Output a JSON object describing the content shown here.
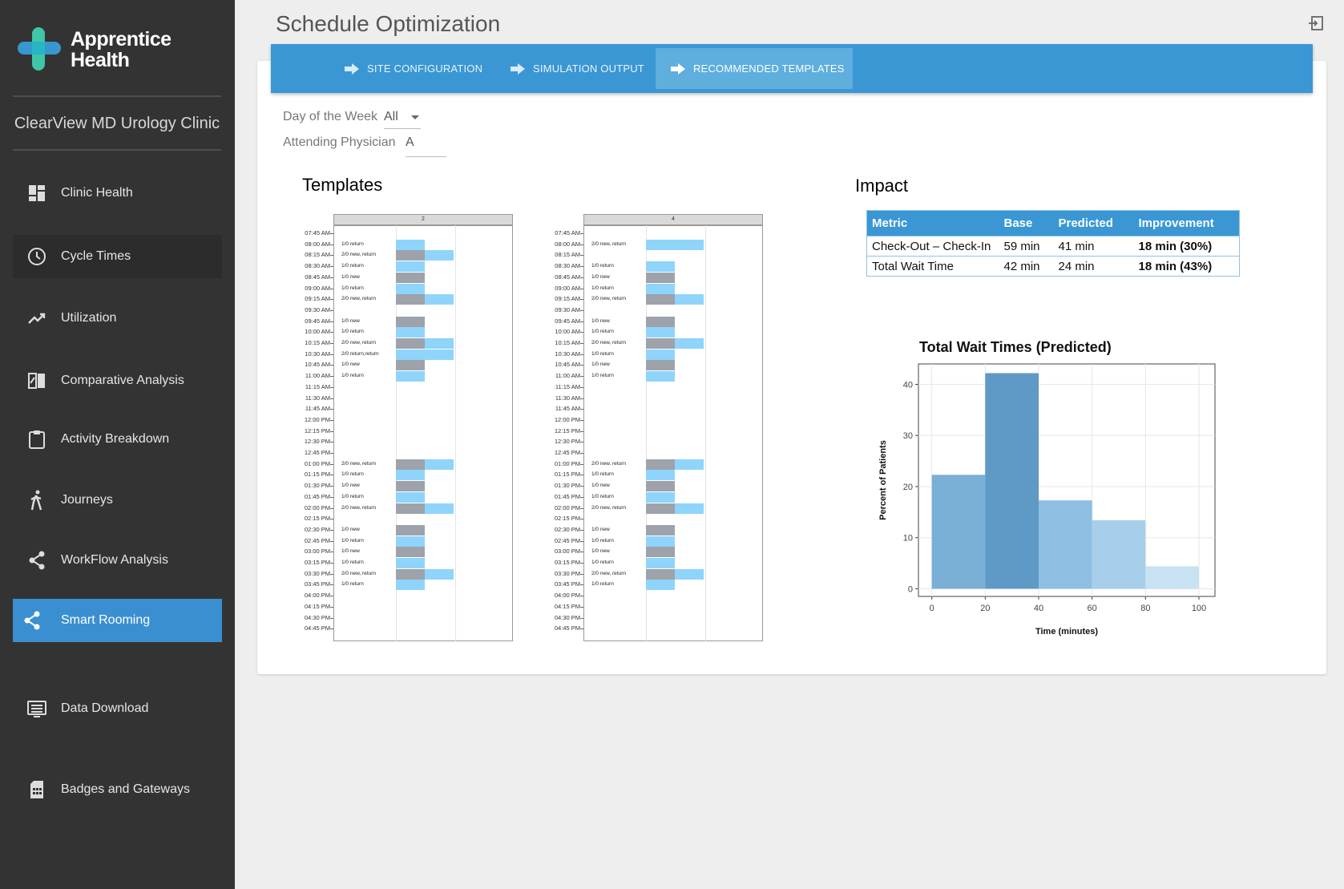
{
  "app": {
    "brand_line1": "Apprentice",
    "brand_line2": "Health",
    "clinic_name": "ClearView MD Urology Clinic",
    "logo_colors": [
      "#3ec6a8",
      "#36a3e0"
    ]
  },
  "sidebar": {
    "items": [
      {
        "label": "Clinic Health",
        "icon": "dashboard-icon"
      },
      {
        "label": "Cycle Times",
        "icon": "clock-icon"
      },
      {
        "label": "Utilization",
        "icon": "trend-icon"
      },
      {
        "label": "Comparative Analysis",
        "icon": "compare-icon"
      },
      {
        "label": "Activity Breakdown",
        "icon": "clipboard-icon"
      },
      {
        "label": "Journeys",
        "icon": "walking-icon"
      },
      {
        "label": "WorkFlow Analysis",
        "icon": "share-icon"
      },
      {
        "label": "Smart Rooming",
        "icon": "share-icon",
        "active": true
      },
      {
        "label": "Data Download",
        "icon": "list-icon"
      },
      {
        "label": "Badges and Gateways",
        "icon": "sim-card-icon"
      }
    ],
    "active_color": "#3a8fd1"
  },
  "header": {
    "title": "Schedule Optimization"
  },
  "tabs": [
    {
      "label": "SITE CONFIGURATION"
    },
    {
      "label": "SIMULATION OUTPUT"
    },
    {
      "label": "RECOMMENDED TEMPLATES",
      "active": true
    }
  ],
  "filters": {
    "day_label": "Day of the Week",
    "day_value": "All",
    "physician_label": "Attending Physician",
    "physician_value": "A"
  },
  "templates": {
    "title": "Templates",
    "times": [
      "07:45 AM",
      "08:00 AM",
      "08:15 AM",
      "08:30 AM",
      "08:45 AM",
      "09:00 AM",
      "09:15 AM",
      "09:30 AM",
      "09:45 AM",
      "10:00 AM",
      "10:15 AM",
      "10:30 AM",
      "10:45 AM",
      "11:00 AM",
      "11:15 AM",
      "11:30 AM",
      "11:45 AM",
      "12:00 PM",
      "12:15 PM",
      "12:30 PM",
      "12:45 PM",
      "01:00 PM",
      "01:15 PM",
      "01:30 PM",
      "01:45 PM",
      "02:00 PM",
      "02:15 PM",
      "02:30 PM",
      "02:45 PM",
      "03:00 PM",
      "03:15 PM",
      "03:30 PM",
      "03:45 PM",
      "04:00 PM",
      "04:15 PM",
      "04:30 PM",
      "04:45 PM"
    ],
    "panels": [
      {
        "header": "2",
        "slots": [
          {
            "row": 1,
            "text": "1/0 return",
            "blocks": [
              "blue"
            ]
          },
          {
            "row": 2,
            "text": "2/0 new, return",
            "blocks": [
              "gray",
              "blue"
            ]
          },
          {
            "row": 3,
            "text": "1/0 return",
            "blocks": [
              "blue"
            ]
          },
          {
            "row": 4,
            "text": "1/0 new",
            "blocks": [
              "gray"
            ]
          },
          {
            "row": 5,
            "text": "1/0 return",
            "blocks": [
              "blue"
            ]
          },
          {
            "row": 6,
            "text": "2/0 new, return",
            "blocks": [
              "gray",
              "blue"
            ]
          },
          {
            "row": 8,
            "text": "1/0 new",
            "blocks": [
              "gray"
            ]
          },
          {
            "row": 9,
            "text": "1/0 return",
            "blocks": [
              "blue"
            ]
          },
          {
            "row": 10,
            "text": "2/0 new, return",
            "blocks": [
              "gray",
              "blue"
            ]
          },
          {
            "row": 11,
            "text": "2/0 return,return",
            "blocks": [
              "blue",
              "blue"
            ]
          },
          {
            "row": 12,
            "text": "1/0 new",
            "blocks": [
              "gray"
            ]
          },
          {
            "row": 13,
            "text": "1/0 return",
            "blocks": [
              "blue"
            ]
          },
          {
            "row": 21,
            "text": "2/0 new, return",
            "blocks": [
              "gray",
              "blue"
            ]
          },
          {
            "row": 22,
            "text": "1/0 return",
            "blocks": [
              "blue"
            ]
          },
          {
            "row": 23,
            "text": "1/0 new",
            "blocks": [
              "gray"
            ]
          },
          {
            "row": 24,
            "text": "1/0 return",
            "blocks": [
              "blue"
            ]
          },
          {
            "row": 25,
            "text": "2/0 new, return",
            "blocks": [
              "gray",
              "blue"
            ]
          },
          {
            "row": 27,
            "text": "1/0 new",
            "blocks": [
              "gray"
            ]
          },
          {
            "row": 28,
            "text": "1/0 return",
            "blocks": [
              "blue"
            ]
          },
          {
            "row": 29,
            "text": "1/0 new",
            "blocks": [
              "gray"
            ]
          },
          {
            "row": 30,
            "text": "1/0 return",
            "blocks": [
              "blue"
            ]
          },
          {
            "row": 31,
            "text": "2/0 new, return",
            "blocks": [
              "gray",
              "blue"
            ]
          },
          {
            "row": 32,
            "text": "1/0 return",
            "blocks": [
              "blue"
            ]
          }
        ]
      },
      {
        "header": "4",
        "slots": [
          {
            "row": 1,
            "text": "2/0 new, return",
            "blocks": [
              "blue",
              "blue"
            ]
          },
          {
            "row": 3,
            "text": "1/0 return",
            "blocks": [
              "blue"
            ]
          },
          {
            "row": 4,
            "text": "1/0 new",
            "blocks": [
              "gray"
            ]
          },
          {
            "row": 5,
            "text": "1/0 return",
            "blocks": [
              "blue"
            ]
          },
          {
            "row": 6,
            "text": "2/0 new, return",
            "blocks": [
              "gray",
              "blue"
            ]
          },
          {
            "row": 8,
            "text": "1/0 new",
            "blocks": [
              "gray"
            ]
          },
          {
            "row": 9,
            "text": "1/0 return",
            "blocks": [
              "blue"
            ]
          },
          {
            "row": 10,
            "text": "2/0 new, return",
            "blocks": [
              "gray",
              "blue"
            ]
          },
          {
            "row": 11,
            "text": "1/0 return",
            "blocks": [
              "blue"
            ]
          },
          {
            "row": 12,
            "text": "1/0 new",
            "blocks": [
              "gray"
            ]
          },
          {
            "row": 13,
            "text": "1/0 return",
            "blocks": [
              "blue"
            ]
          },
          {
            "row": 21,
            "text": "2/0 new, return",
            "blocks": [
              "gray",
              "blue"
            ]
          },
          {
            "row": 22,
            "text": "1/0 return",
            "blocks": [
              "blue"
            ]
          },
          {
            "row": 23,
            "text": "1/0 new",
            "blocks": [
              "gray"
            ]
          },
          {
            "row": 24,
            "text": "1/0 return",
            "blocks": [
              "blue"
            ]
          },
          {
            "row": 25,
            "text": "2/0 new, return",
            "blocks": [
              "gray",
              "blue"
            ]
          },
          {
            "row": 27,
            "text": "1/0 new",
            "blocks": [
              "gray"
            ]
          },
          {
            "row": 28,
            "text": "1/0 return",
            "blocks": [
              "blue"
            ]
          },
          {
            "row": 29,
            "text": "1/0 new",
            "blocks": [
              "gray"
            ]
          },
          {
            "row": 30,
            "text": "1/0 return",
            "blocks": [
              "blue"
            ]
          },
          {
            "row": 31,
            "text": "2/0 new, return",
            "blocks": [
              "gray",
              "blue"
            ]
          },
          {
            "row": 32,
            "text": "1/0 return",
            "blocks": [
              "blue"
            ]
          }
        ]
      }
    ]
  },
  "impact": {
    "title": "Impact",
    "columns": [
      "Metric",
      "Base",
      "Predicted",
      "Improvement"
    ],
    "rows": [
      [
        "Check-Out – Check-In",
        "59 min",
        "41 min",
        "18 min (30%)"
      ],
      [
        "Total Wait Time",
        "42 min",
        "24 min",
        "18 min (43%)"
      ]
    ]
  },
  "chart_data": {
    "type": "bar",
    "title": "Total Wait Times (Predicted)",
    "xlabel": "Time (minutes)",
    "ylabel": "Percent of Patients",
    "bins": [
      [
        0,
        20
      ],
      [
        20,
        40
      ],
      [
        40,
        60
      ],
      [
        60,
        80
      ],
      [
        80,
        100
      ]
    ],
    "values": [
      22.3,
      42.2,
      17.3,
      13.4,
      4.4
    ],
    "colors": [
      "#7aafd6",
      "#5f99c6",
      "#8ebfe2",
      "#a7cfec",
      "#c8e2f4"
    ],
    "xlim": [
      -5,
      106
    ],
    "ylim": [
      -1.5,
      44
    ],
    "xticks": [
      0,
      20,
      40,
      60,
      80,
      100
    ],
    "yticks": [
      0,
      10,
      20,
      30,
      40
    ],
    "grid": true
  }
}
